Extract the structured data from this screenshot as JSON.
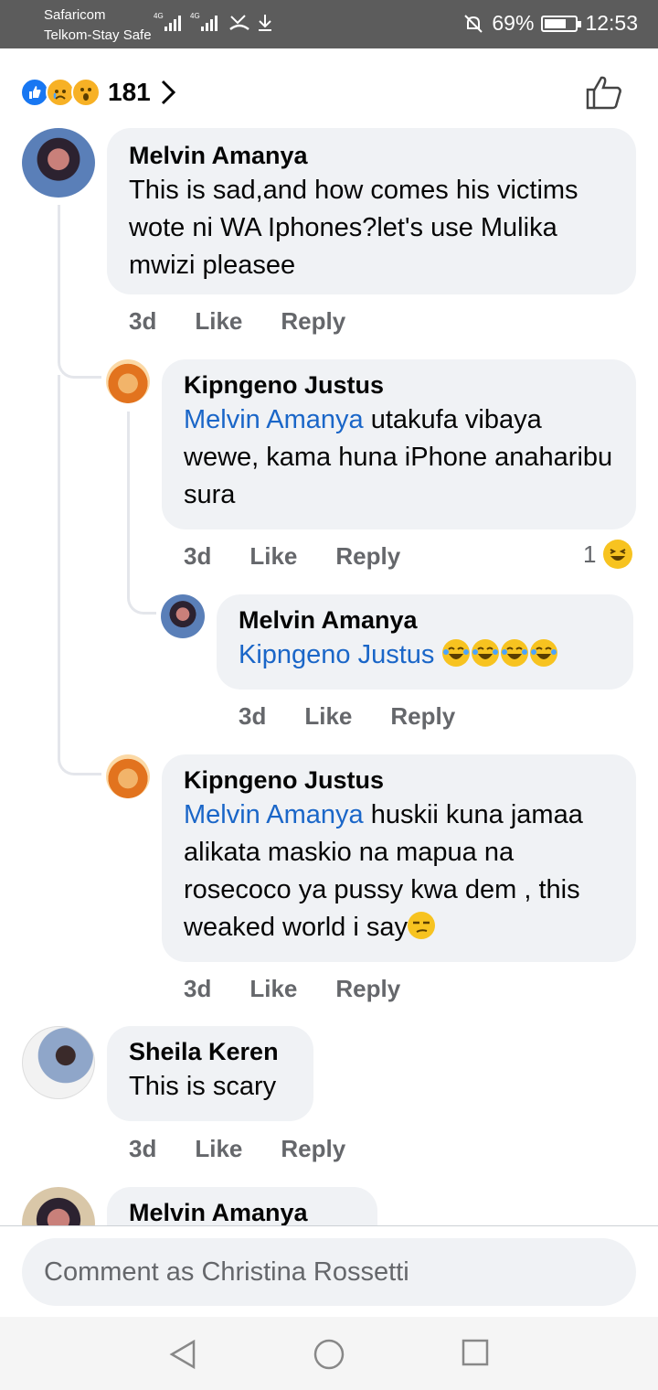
{
  "status_bar": {
    "carrier1": "Safaricom",
    "carrier2": "Telkom-Stay Safe",
    "signal_tag": "4G",
    "battery": "69%",
    "battery_level": 0.69,
    "time": "12:53"
  },
  "reactions": {
    "icons": [
      "like-icon",
      "sad-face-icon",
      "wow-face-icon"
    ],
    "count": "181"
  },
  "comments": [
    {
      "name": "Melvin Amanya",
      "text": "This is sad,and how comes his victims wote ni WA Iphones?let's use Mulika mwizi pleasee",
      "time": "3d",
      "like": "Like",
      "reply": "Reply",
      "replies": [
        {
          "name": "Kipngeno Justus",
          "mention": "Melvin Amanya",
          "text": " utakufa vibaya wewe, kama huna iPhone anaharibu sura",
          "time": "3d",
          "like": "Like",
          "reply": "Reply",
          "reaction_count": "1",
          "reaction_icon": "laughing-face-icon"
        },
        {
          "name": "Melvin Amanya",
          "mention": "Kipngeno Justus",
          "text": "",
          "emojis": [
            "tears-of-joy-icon",
            "tears-of-joy-icon",
            "tears-of-joy-icon",
            "tears-of-joy-icon"
          ],
          "time": "3d",
          "like": "Like",
          "reply": "Reply"
        },
        {
          "name": "Kipngeno Justus",
          "mention": "Melvin Amanya",
          "text": " huskii kuna jamaa alikata maskio na mapua na rosecoco ya pussy kwa dem , this weaked world i say",
          "emoji": "unamused-face-icon",
          "time": "3d",
          "like": "Like",
          "reply": "Reply"
        }
      ]
    },
    {
      "name": "Sheila Keren",
      "text": "This is scary",
      "time": "3d",
      "like": "Like",
      "reply": "Reply"
    },
    {
      "name": "Melvin Amanya"
    }
  ],
  "composer": {
    "placeholder": "Comment as Christina Rossetti"
  },
  "colors": {
    "accent": "#1877f2",
    "mention": "#1a66c8",
    "bubble": "#f0f2f5",
    "status_bar": "#5c5c5c"
  }
}
